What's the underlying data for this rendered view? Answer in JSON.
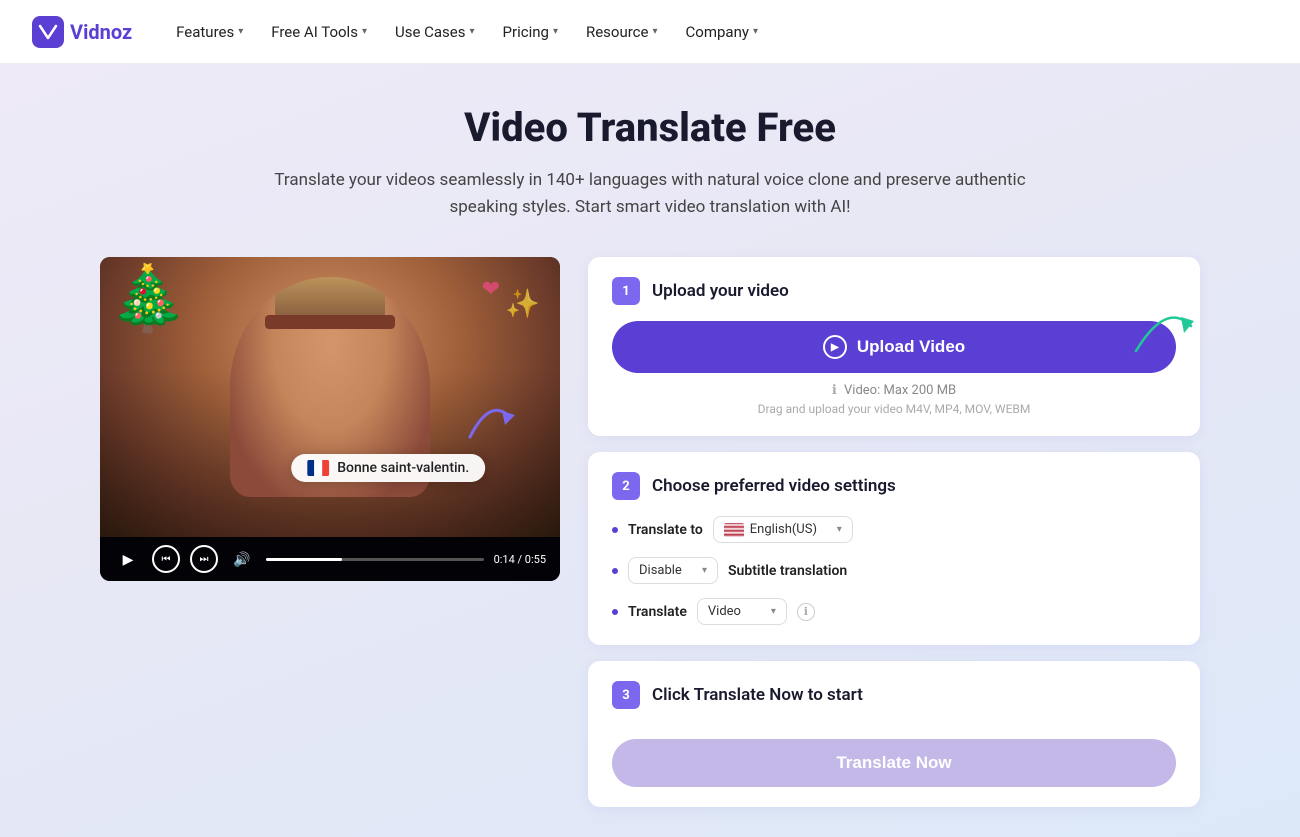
{
  "logo": {
    "text": "Vidnoz"
  },
  "nav": {
    "items": [
      {
        "label": "Features",
        "has_dropdown": true
      },
      {
        "label": "Free AI Tools",
        "has_dropdown": true
      },
      {
        "label": "Use Cases",
        "has_dropdown": true
      },
      {
        "label": "Pricing",
        "has_dropdown": true
      },
      {
        "label": "Resource",
        "has_dropdown": true
      },
      {
        "label": "Company",
        "has_dropdown": true
      }
    ]
  },
  "hero": {
    "title": "Video Translate Free",
    "subtitle": "Translate your videos seamlessly in 140+ languages with natural voice clone and preserve authentic speaking styles. Start smart video translation with AI!"
  },
  "step1": {
    "badge": "1",
    "title": "Upload your video",
    "upload_btn": "Upload Video",
    "video_max": "Video: Max 200 MB",
    "formats": "Drag and upload your video M4V, MP4, MOV, WEBM"
  },
  "step2": {
    "badge": "2",
    "title": "Choose preferred video settings",
    "translate_to_label": "Translate to",
    "language": "English(US)",
    "subtitle_label": "Subtitle translation",
    "subtitle_option": "Disable",
    "translate_label": "Translate",
    "translate_option": "Video"
  },
  "step3": {
    "badge": "3",
    "title": "Click Translate Now to start",
    "btn_label": "Translate Now"
  },
  "video": {
    "subtitle_text": "Bonne saint-valentin.",
    "time": "0:14 / 0:55"
  }
}
